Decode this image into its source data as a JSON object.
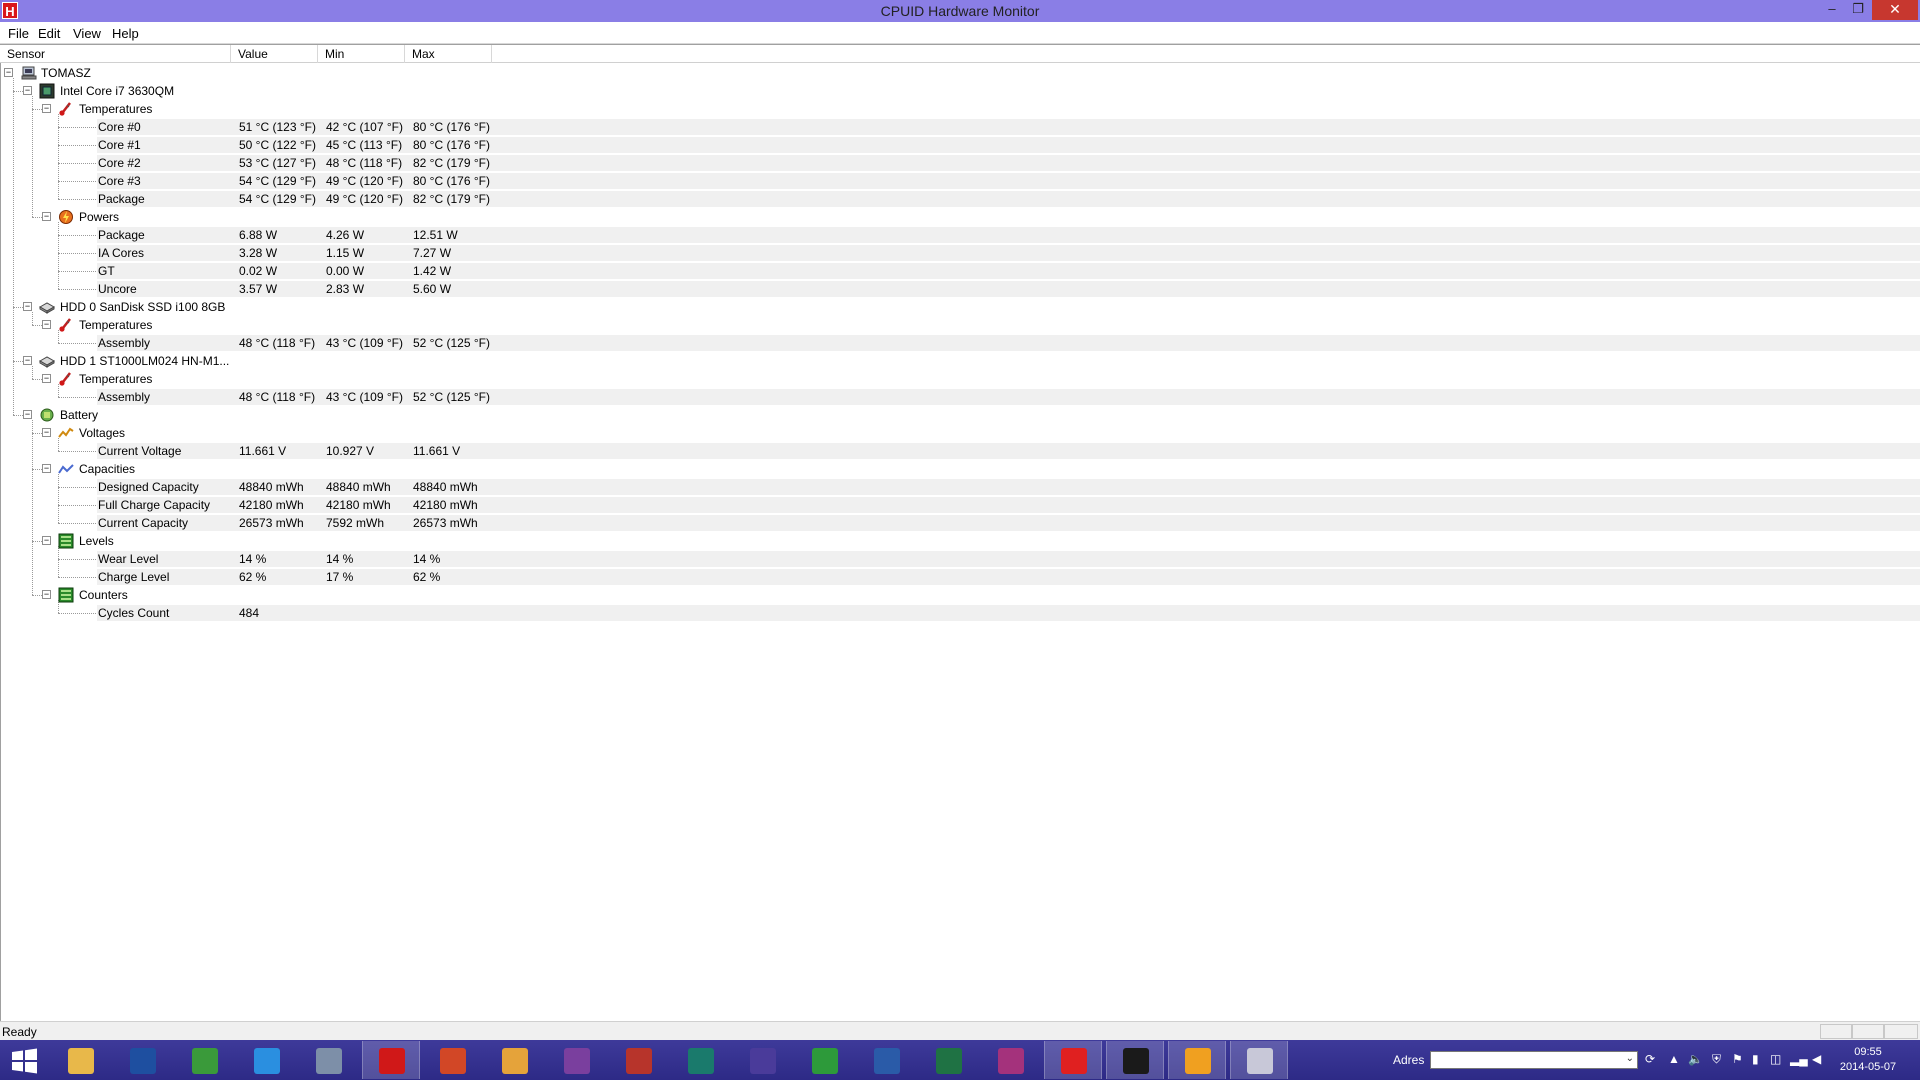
{
  "window": {
    "title": "CPUID Hardware Monitor",
    "minimize": "–",
    "restore": "❐",
    "close": "✕"
  },
  "menu": [
    "File",
    "Edit",
    "View",
    "Help"
  ],
  "columns": [
    "Sensor",
    "Value",
    "Min",
    "Max"
  ],
  "tree": [
    {
      "level": 0,
      "type": "node",
      "icon": "computer-icon",
      "label": "TOMASZ"
    },
    {
      "level": 1,
      "type": "node",
      "icon": "cpu-chip-icon",
      "label": "Intel Core i7 3630QM"
    },
    {
      "level": 2,
      "type": "node",
      "icon": "thermometer-icon",
      "label": "Temperatures"
    },
    {
      "level": 3,
      "type": "leaf",
      "label": "Core #0",
      "value": "51 °C  (123 °F)",
      "min": "42 °C  (107 °F)",
      "max": "80 °C  (176 °F)"
    },
    {
      "level": 3,
      "type": "leaf",
      "label": "Core #1",
      "value": "50 °C  (122 °F)",
      "min": "45 °C  (113 °F)",
      "max": "80 °C  (176 °F)"
    },
    {
      "level": 3,
      "type": "leaf",
      "label": "Core #2",
      "value": "53 °C  (127 °F)",
      "min": "48 °C  (118 °F)",
      "max": "82 °C  (179 °F)"
    },
    {
      "level": 3,
      "type": "leaf",
      "label": "Core #3",
      "value": "54 °C  (129 °F)",
      "min": "49 °C  (120 °F)",
      "max": "80 °C  (176 °F)"
    },
    {
      "level": 3,
      "type": "leaf",
      "label": "Package",
      "value": "54 °C  (129 °F)",
      "min": "49 °C  (120 °F)",
      "max": "82 °C  (179 °F)"
    },
    {
      "level": 2,
      "type": "node",
      "icon": "power-icon",
      "label": "Powers"
    },
    {
      "level": 3,
      "type": "leaf",
      "label": "Package",
      "value": "6.88 W",
      "min": "4.26 W",
      "max": "12.51 W"
    },
    {
      "level": 3,
      "type": "leaf",
      "label": "IA Cores",
      "value": "3.28 W",
      "min": "1.15 W",
      "max": "7.27 W"
    },
    {
      "level": 3,
      "type": "leaf",
      "label": "GT",
      "value": "0.02 W",
      "min": "0.00 W",
      "max": "1.42 W"
    },
    {
      "level": 3,
      "type": "leaf",
      "label": "Uncore",
      "value": "3.57 W",
      "min": "2.83 W",
      "max": "5.60 W"
    },
    {
      "level": 1,
      "type": "node",
      "icon": "hard-drive-icon",
      "label": "HDD 0 SanDisk SSD i100 8GB"
    },
    {
      "level": 2,
      "type": "node",
      "icon": "thermometer-icon",
      "label": "Temperatures"
    },
    {
      "level": 3,
      "type": "leaf",
      "label": "Assembly",
      "value": "48 °C  (118 °F)",
      "min": "43 °C  (109 °F)",
      "max": "52 °C  (125 °F)"
    },
    {
      "level": 1,
      "type": "node",
      "icon": "hard-drive-icon",
      "label": "HDD 1 ST1000LM024 HN-M1..."
    },
    {
      "level": 2,
      "type": "node",
      "icon": "thermometer-icon",
      "label": "Temperatures"
    },
    {
      "level": 3,
      "type": "leaf",
      "label": "Assembly",
      "value": "48 °C  (118 °F)",
      "min": "43 °C  (109 °F)",
      "max": "52 °C  (125 °F)"
    },
    {
      "level": 1,
      "type": "node",
      "icon": "battery-icon",
      "label": "Battery"
    },
    {
      "level": 2,
      "type": "node",
      "icon": "voltage-icon",
      "label": "Voltages"
    },
    {
      "level": 3,
      "type": "leaf",
      "label": "Current Voltage",
      "value": "11.661 V",
      "min": "10.927 V",
      "max": "11.661 V"
    },
    {
      "level": 2,
      "type": "node",
      "icon": "capacity-icon",
      "label": "Capacities"
    },
    {
      "level": 3,
      "type": "leaf",
      "label": "Designed Capacity",
      "value": "48840 mWh",
      "min": "48840 mWh",
      "max": "48840 mWh"
    },
    {
      "level": 3,
      "type": "leaf",
      "label": "Full Charge Capacity",
      "value": "42180 mWh",
      "min": "42180 mWh",
      "max": "42180 mWh"
    },
    {
      "level": 3,
      "type": "leaf",
      "label": "Current Capacity",
      "value": "26573 mWh",
      "min": "7592 mWh",
      "max": "26573 mWh"
    },
    {
      "level": 2,
      "type": "node",
      "icon": "levels-icon",
      "label": "Levels"
    },
    {
      "level": 3,
      "type": "leaf",
      "label": "Wear Level",
      "value": "14 %",
      "min": "14 %",
      "max": "14 %"
    },
    {
      "level": 3,
      "type": "leaf",
      "label": "Charge Level",
      "value": "62 %",
      "min": "17 %",
      "max": "62 %"
    },
    {
      "level": 2,
      "type": "node",
      "icon": "counters-icon",
      "label": "Counters"
    },
    {
      "level": 3,
      "type": "leaf",
      "label": "Cycles Count",
      "value": "484",
      "min": "",
      "max": ""
    }
  ],
  "status": "Ready",
  "taskbar": {
    "apps": [
      {
        "name": "file-explorer",
        "color": "#e8b84a"
      },
      {
        "name": "help",
        "color": "#1e4fa0"
      },
      {
        "name": "chrome",
        "color": "#3a9a3a"
      },
      {
        "name": "internet-explorer",
        "color": "#2a8fe0"
      },
      {
        "name": "calculator",
        "color": "#7d8fa8"
      },
      {
        "name": "opera",
        "color": "#d01818",
        "active": true
      },
      {
        "name": "office-app-red",
        "color": "#d24726"
      },
      {
        "name": "outlook",
        "color": "#e5a33a"
      },
      {
        "name": "onenote",
        "color": "#7a3f9e"
      },
      {
        "name": "access",
        "color": "#b7342b"
      },
      {
        "name": "publisher",
        "color": "#1a7a6c"
      },
      {
        "name": "project",
        "color": "#4a3b9a"
      },
      {
        "name": "sync-app",
        "color": "#2d9a3a"
      },
      {
        "name": "word",
        "color": "#2a5ba8"
      },
      {
        "name": "excel",
        "color": "#1f7244"
      },
      {
        "name": "infopath",
        "color": "#a4327c"
      },
      {
        "name": "flash-red",
        "color": "#e02020",
        "active": true
      },
      {
        "name": "flash-black",
        "color": "#1a1a1a",
        "active": true
      },
      {
        "name": "hwmonitor",
        "color": "#f0a020",
        "active": true
      },
      {
        "name": "paint",
        "color": "#c8c8d8",
        "active": true
      }
    ],
    "address_label": "Adres",
    "address_value": "",
    "clock_time": "09:55",
    "clock_date": "2014-05-07"
  }
}
